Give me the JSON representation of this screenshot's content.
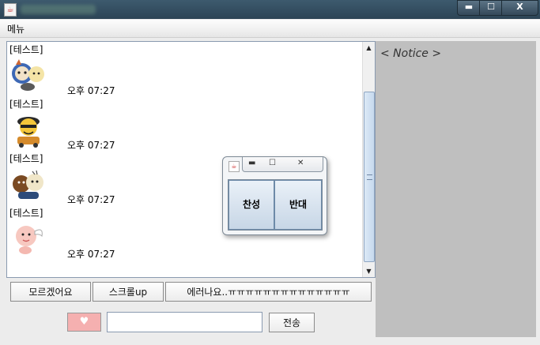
{
  "window": {
    "title_icon": "java-cup-icon"
  },
  "titlebar_buttons": {
    "minimize": "▬",
    "maximize": "☐",
    "close": "X"
  },
  "menu": {
    "label": "메뉴"
  },
  "chat": {
    "messages": [
      {
        "name": "[테스트]",
        "time": "오후 07:27",
        "emoticon": "kakao-emoticon-1"
      },
      {
        "name": "[테스트]",
        "time": "오후 07:27",
        "emoticon": "kakao-emoticon-2"
      },
      {
        "name": "[테스트]",
        "time": "오후 07:27",
        "emoticon": "kakao-emoticon-3"
      },
      {
        "name": "[테스트]",
        "time": "오후 07:27",
        "emoticon": "kakao-emoticon-4"
      }
    ]
  },
  "buttons": {
    "unknown": "모르겠어요",
    "scroll_up": "스크롤up",
    "error": "에러나요..ㅠㅠㅠㅠㅠㅠㅠㅠㅠㅠㅠㅠㅠㅠ"
  },
  "send": {
    "heart": "♥",
    "send_label": "전송",
    "input_value": ""
  },
  "notice": {
    "label": "< Notice >"
  },
  "vote_popup": {
    "agree": "찬성",
    "disagree": "반대"
  },
  "colors": {
    "notice_bg": "#bfbfbf",
    "heart_bg": "#f5b0b0",
    "titlebar": "#2c4455"
  }
}
